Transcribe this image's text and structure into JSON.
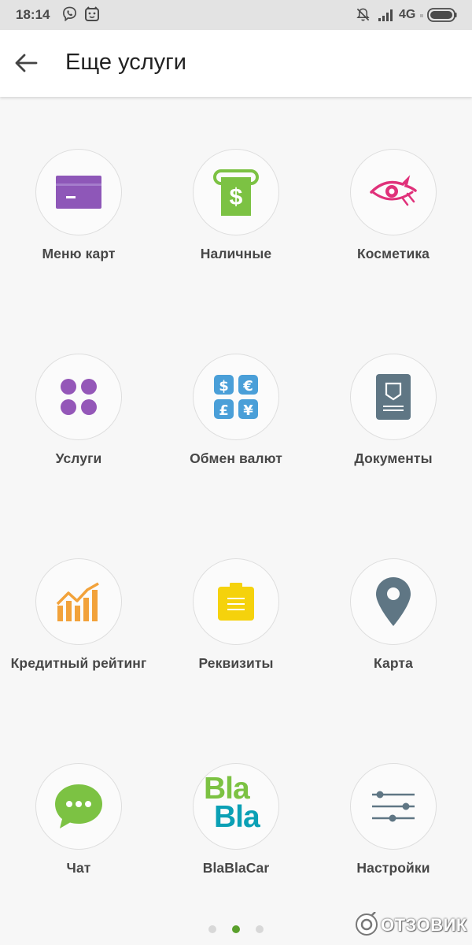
{
  "status_bar": {
    "time": "18:14",
    "network": "4G",
    "network_sub": "ıı"
  },
  "header": {
    "title": "Еще услуги"
  },
  "services": [
    {
      "label": "Меню карт",
      "icon": "card-icon",
      "color": "#8e57b8"
    },
    {
      "label": "Наличные",
      "icon": "cash-icon",
      "color": "#7cc243"
    },
    {
      "label": "Косметика",
      "icon": "eye-icon",
      "color": "#e0317a"
    },
    {
      "label": "Услуги",
      "icon": "four-dots-icon",
      "color": "#9457b8"
    },
    {
      "label": "Обмен валют",
      "icon": "currency-exchange-icon",
      "color": "#4a9fd8"
    },
    {
      "label": "Документы",
      "icon": "document-icon",
      "color": "#5f7684"
    },
    {
      "label": "Кредитный рейтинг",
      "icon": "rating-chart-icon",
      "color": "#f2a23a"
    },
    {
      "label": "Реквизиты",
      "icon": "clipboard-icon",
      "color": "#f5d20c"
    },
    {
      "label": "Карта",
      "icon": "map-pin-icon",
      "color": "#5f7684"
    },
    {
      "label": "Чат",
      "icon": "chat-icon",
      "color": "#7cc243"
    },
    {
      "label": "BlaBlaCar",
      "icon": "blablacar-logo-icon",
      "color": "#0aa0b5"
    },
    {
      "label": "Настройки",
      "icon": "sliders-icon",
      "color": "#5f7684"
    }
  ],
  "blablacar_logo": {
    "line1": "Bla",
    "line2": "Bla"
  },
  "pagination": {
    "pages": 3,
    "active": 2,
    "active_color": "#5aa02c"
  },
  "watermark": {
    "text": "ОТЗОВИК"
  }
}
